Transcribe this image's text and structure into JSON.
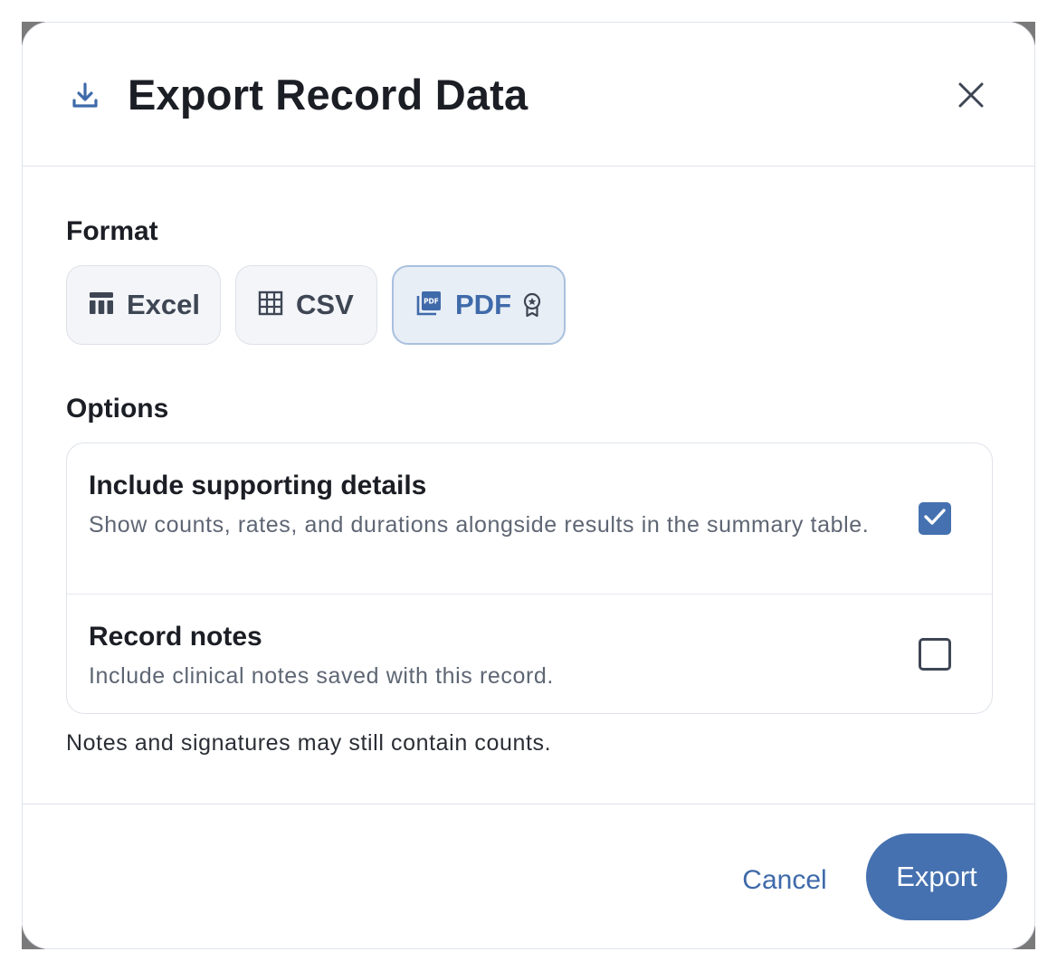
{
  "dialog": {
    "title": "Export Record Data",
    "header_icon": "download-icon",
    "close_icon": "close-icon"
  },
  "format": {
    "label": "Format",
    "selected": "PDF",
    "options": [
      {
        "label": "Excel",
        "icon": "table-icon"
      },
      {
        "label": "CSV",
        "icon": "grid-icon"
      },
      {
        "label": "PDF",
        "icon": "pdf-icon",
        "badge_icon": "award-icon"
      }
    ]
  },
  "options": {
    "label": "Options",
    "items": [
      {
        "title": "Include supporting details",
        "description": "Show counts, rates, and durations alongside results in the summary table.",
        "checked": true
      },
      {
        "title": "Record notes",
        "description": "Include clinical notes saved with this record.",
        "checked": false
      }
    ],
    "note": "Notes and signatures may still contain counts."
  },
  "footer": {
    "cancel_label": "Cancel",
    "export_label": "Export"
  },
  "colors": {
    "accent": "#4571b0",
    "selected_bg": "#e8eef6",
    "text_primary": "#1b1e24",
    "text_secondary": "#5e6674"
  }
}
